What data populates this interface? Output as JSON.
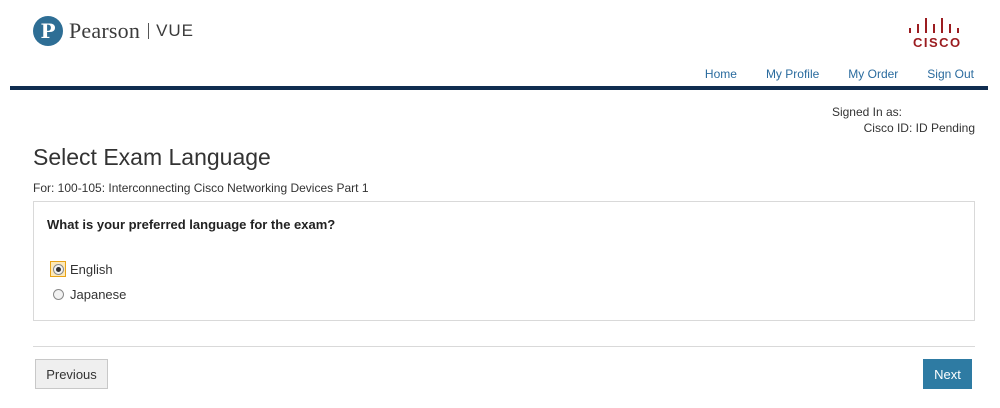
{
  "header": {
    "brand_logo_letter": "P",
    "brand_name": "Pearson",
    "brand_product": "VUE",
    "partner_logo": "cisco",
    "nav": [
      "Home",
      "My Profile",
      "My Order",
      "Sign Out"
    ]
  },
  "account": {
    "signed_in_label": "Signed In as:",
    "cisco_id": "Cisco ID: ID Pending"
  },
  "page": {
    "title": "Select Exam Language",
    "subtitle": "For: 100-105: Interconnecting Cisco Networking Devices Part 1"
  },
  "question": {
    "text": "What is your preferred language for the exam?",
    "options": [
      {
        "label": "English",
        "selected": true
      },
      {
        "label": "Japanese",
        "selected": false
      }
    ]
  },
  "buttons": {
    "previous": "Previous",
    "next": "Next"
  },
  "colors": {
    "nav_link": "#2a6b9e",
    "nav_rule": "#102d50",
    "next_button": "#2e7ba3",
    "pearson_blue": "#2e6e95",
    "cisco_red": "#9b1c20"
  },
  "icons": {
    "pearson": "pearson-p-logo",
    "cisco": "cisco-bars-logo"
  }
}
